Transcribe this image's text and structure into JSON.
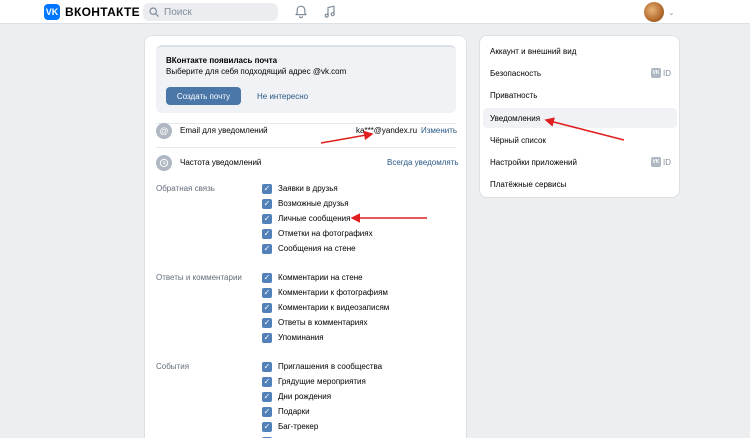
{
  "header": {
    "logo_mark": "VK",
    "logo_text": "ВКОНТАКТЕ",
    "search_placeholder": "Поиск",
    "icons": [
      "bell-icon",
      "music-icon",
      "avatar",
      "chevron-down-icon"
    ]
  },
  "promo": {
    "title": "ВКонтакте появилась почта",
    "subtitle": "Выберите для себя подходящий адрес @vk.com",
    "primary_button": "Создать почту",
    "secondary_link": "Не интересно"
  },
  "email_row": {
    "label": "Email для уведомлений",
    "value": "ka***@yandex.ru",
    "action": "Изменить"
  },
  "frequency_row": {
    "label": "Частота уведомлений",
    "value": "Всегда уведомлять"
  },
  "sections": [
    {
      "title": "Обратная связь",
      "items": [
        "Заявки в друзья",
        "Возможные друзья",
        "Личные сообщения",
        "Отметки на фотографиях",
        "Сообщения на стене"
      ]
    },
    {
      "title": "Ответы и комментарии",
      "items": [
        "Комментарии на стене",
        "Комментарии к фотографиям",
        "Комментарии к видеозаписям",
        "Ответы в комментариях",
        "Упоминания"
      ]
    },
    {
      "title": "События",
      "items": [
        "Приглашения в сообщества",
        "Грядущие мероприятия",
        "Дни рождения",
        "Подарки",
        "Баг-трекер"
      ]
    }
  ],
  "menu": {
    "items": [
      "Аккаунт и внешний вид",
      "Безопасность",
      "Приватность",
      "Уведомления",
      "Чёрный список",
      "Настройки приложений",
      "Платёжные сервисы"
    ],
    "active_index": 3,
    "vkid_label": "ID",
    "vkid_mark": "VK"
  },
  "colors": {
    "accent": "#4a76a8",
    "link": "#2a5885",
    "checkbox": "#5181b8",
    "annotation_arrow": "#e02020",
    "background": "#edeef0"
  }
}
